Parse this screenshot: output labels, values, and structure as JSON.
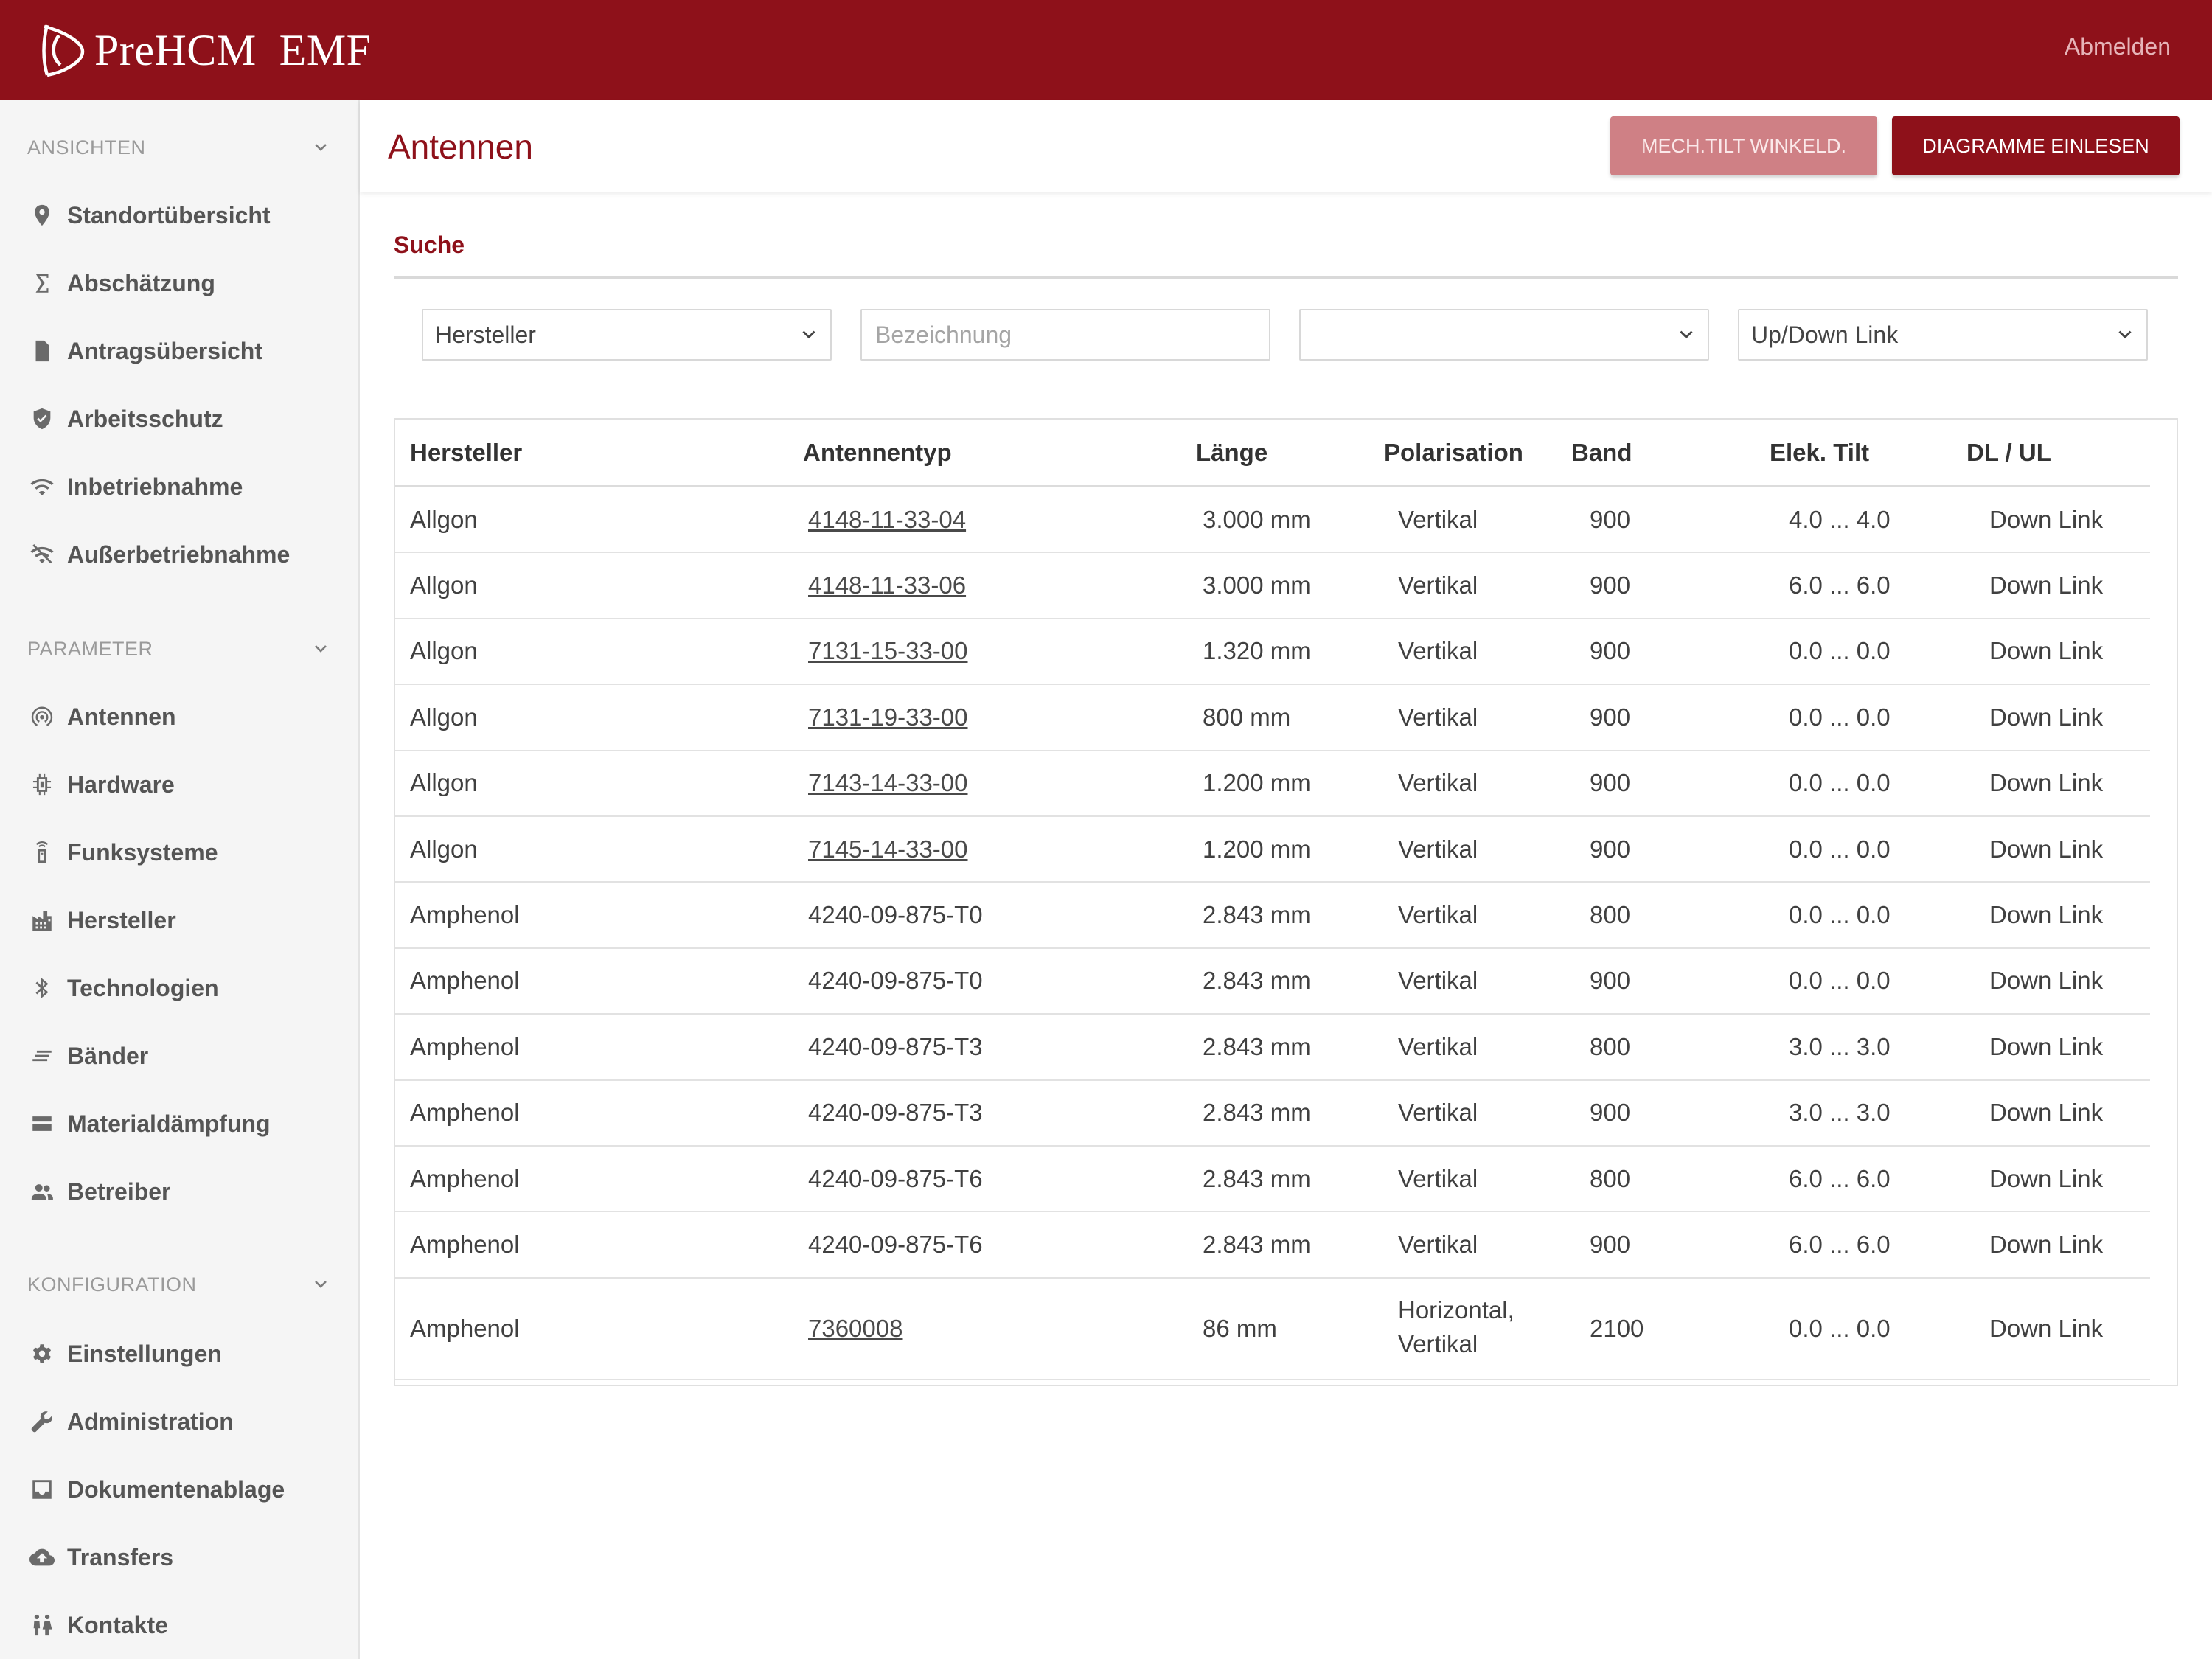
{
  "app": {
    "brand": "PreHCM  EMF",
    "logout": "Abmelden"
  },
  "sidebar": {
    "sections": [
      {
        "title": "ANSICHTEN",
        "items": [
          {
            "label": "Standortübersicht",
            "icon": "location-pin-icon"
          },
          {
            "label": "Abschätzung",
            "icon": "sigma-icon"
          },
          {
            "label": "Antragsübersicht",
            "icon": "document-icon"
          },
          {
            "label": "Arbeitsschutz",
            "icon": "shield-check-icon"
          },
          {
            "label": "Inbetriebnahme",
            "icon": "wifi-icon"
          },
          {
            "label": "Außerbetriebnahme",
            "icon": "wifi-off-icon"
          }
        ]
      },
      {
        "title": "PARAMETER",
        "items": [
          {
            "label": "Antennen",
            "icon": "antenna-icon"
          },
          {
            "label": "Hardware",
            "icon": "chip-icon"
          },
          {
            "label": "Funksysteme",
            "icon": "radio-tower-icon"
          },
          {
            "label": "Hersteller",
            "icon": "factory-icon"
          },
          {
            "label": "Technologien",
            "icon": "bluetooth-icon"
          },
          {
            "label": "Bänder",
            "icon": "lines-icon"
          },
          {
            "label": "Materialdämpfung",
            "icon": "layers-icon"
          },
          {
            "label": "Betreiber",
            "icon": "users-icon"
          }
        ]
      },
      {
        "title": "KONFIGURATION",
        "items": [
          {
            "label": "Einstellungen",
            "icon": "gear-icon"
          },
          {
            "label": "Administration",
            "icon": "wrench-icon"
          },
          {
            "label": "Dokumentenablage",
            "icon": "inbox-icon"
          },
          {
            "label": "Transfers",
            "icon": "cloud-upload-icon"
          },
          {
            "label": "Kontakte",
            "icon": "people-icon"
          }
        ]
      }
    ]
  },
  "header": {
    "title": "Antennen",
    "btn_mech": "MECH.TILT WINKELD.",
    "btn_diag": "DIAGRAMME EINLESEN"
  },
  "search": {
    "title": "Suche",
    "manufacturer_value": "Hersteller",
    "designation_placeholder": "Bezeichnung",
    "third_value": "",
    "link_value": "Up/Down Link"
  },
  "table": {
    "columns": [
      "Hersteller",
      "Antennentyp",
      "Länge",
      "Polarisation",
      "Band",
      "Elek. Tilt",
      "DL / UL"
    ],
    "rows": [
      {
        "hersteller": "Allgon",
        "typ": "4148-11-33-04",
        "link": true,
        "laenge": "3.000 mm",
        "polarisation": "Vertikal",
        "band": "900",
        "tilt": "4.0 ... 4.0",
        "dlul": "Down Link"
      },
      {
        "hersteller": "Allgon",
        "typ": "4148-11-33-06",
        "link": true,
        "laenge": "3.000 mm",
        "polarisation": "Vertikal",
        "band": "900",
        "tilt": "6.0 ... 6.0",
        "dlul": "Down Link"
      },
      {
        "hersteller": "Allgon",
        "typ": "7131-15-33-00",
        "link": true,
        "laenge": "1.320 mm",
        "polarisation": "Vertikal",
        "band": "900",
        "tilt": "0.0 ... 0.0",
        "dlul": "Down Link"
      },
      {
        "hersteller": "Allgon",
        "typ": "7131-19-33-00",
        "link": true,
        "laenge": "800 mm",
        "polarisation": "Vertikal",
        "band": "900",
        "tilt": "0.0 ... 0.0",
        "dlul": "Down Link"
      },
      {
        "hersteller": "Allgon",
        "typ": "7143-14-33-00",
        "link": true,
        "laenge": "1.200 mm",
        "polarisation": "Vertikal",
        "band": "900",
        "tilt": "0.0 ... 0.0",
        "dlul": "Down Link"
      },
      {
        "hersteller": "Allgon",
        "typ": "7145-14-33-00",
        "link": true,
        "laenge": "1.200 mm",
        "polarisation": "Vertikal",
        "band": "900",
        "tilt": "0.0 ... 0.0",
        "dlul": "Down Link"
      },
      {
        "hersteller": "Amphenol",
        "typ": "4240-09-875-T0",
        "link": false,
        "laenge": "2.843 mm",
        "polarisation": "Vertikal",
        "band": "800",
        "tilt": "0.0 ... 0.0",
        "dlul": "Down Link"
      },
      {
        "hersteller": "Amphenol",
        "typ": "4240-09-875-T0",
        "link": false,
        "laenge": "2.843 mm",
        "polarisation": "Vertikal",
        "band": "900",
        "tilt": "0.0 ... 0.0",
        "dlul": "Down Link"
      },
      {
        "hersteller": "Amphenol",
        "typ": "4240-09-875-T3",
        "link": false,
        "laenge": "2.843 mm",
        "polarisation": "Vertikal",
        "band": "800",
        "tilt": "3.0 ... 3.0",
        "dlul": "Down Link"
      },
      {
        "hersteller": "Amphenol",
        "typ": "4240-09-875-T3",
        "link": false,
        "laenge": "2.843 mm",
        "polarisation": "Vertikal",
        "band": "900",
        "tilt": "3.0 ... 3.0",
        "dlul": "Down Link"
      },
      {
        "hersteller": "Amphenol",
        "typ": "4240-09-875-T6",
        "link": false,
        "laenge": "2.843 mm",
        "polarisation": "Vertikal",
        "band": "800",
        "tilt": "6.0 ... 6.0",
        "dlul": "Down Link"
      },
      {
        "hersteller": "Amphenol",
        "typ": "4240-09-875-T6",
        "link": false,
        "laenge": "2.843 mm",
        "polarisation": "Vertikal",
        "band": "900",
        "tilt": "6.0 ... 6.0",
        "dlul": "Down Link"
      },
      {
        "hersteller": "Amphenol",
        "typ": "7360008",
        "link": true,
        "laenge": "86 mm",
        "polarisation": "Horizontal,\nVertikal",
        "band": "2100",
        "tilt": "0.0 ... 0.0",
        "dlul": "Down Link"
      }
    ]
  },
  "colors": {
    "brand": "#8e111a",
    "button_light": "#cf8085"
  }
}
